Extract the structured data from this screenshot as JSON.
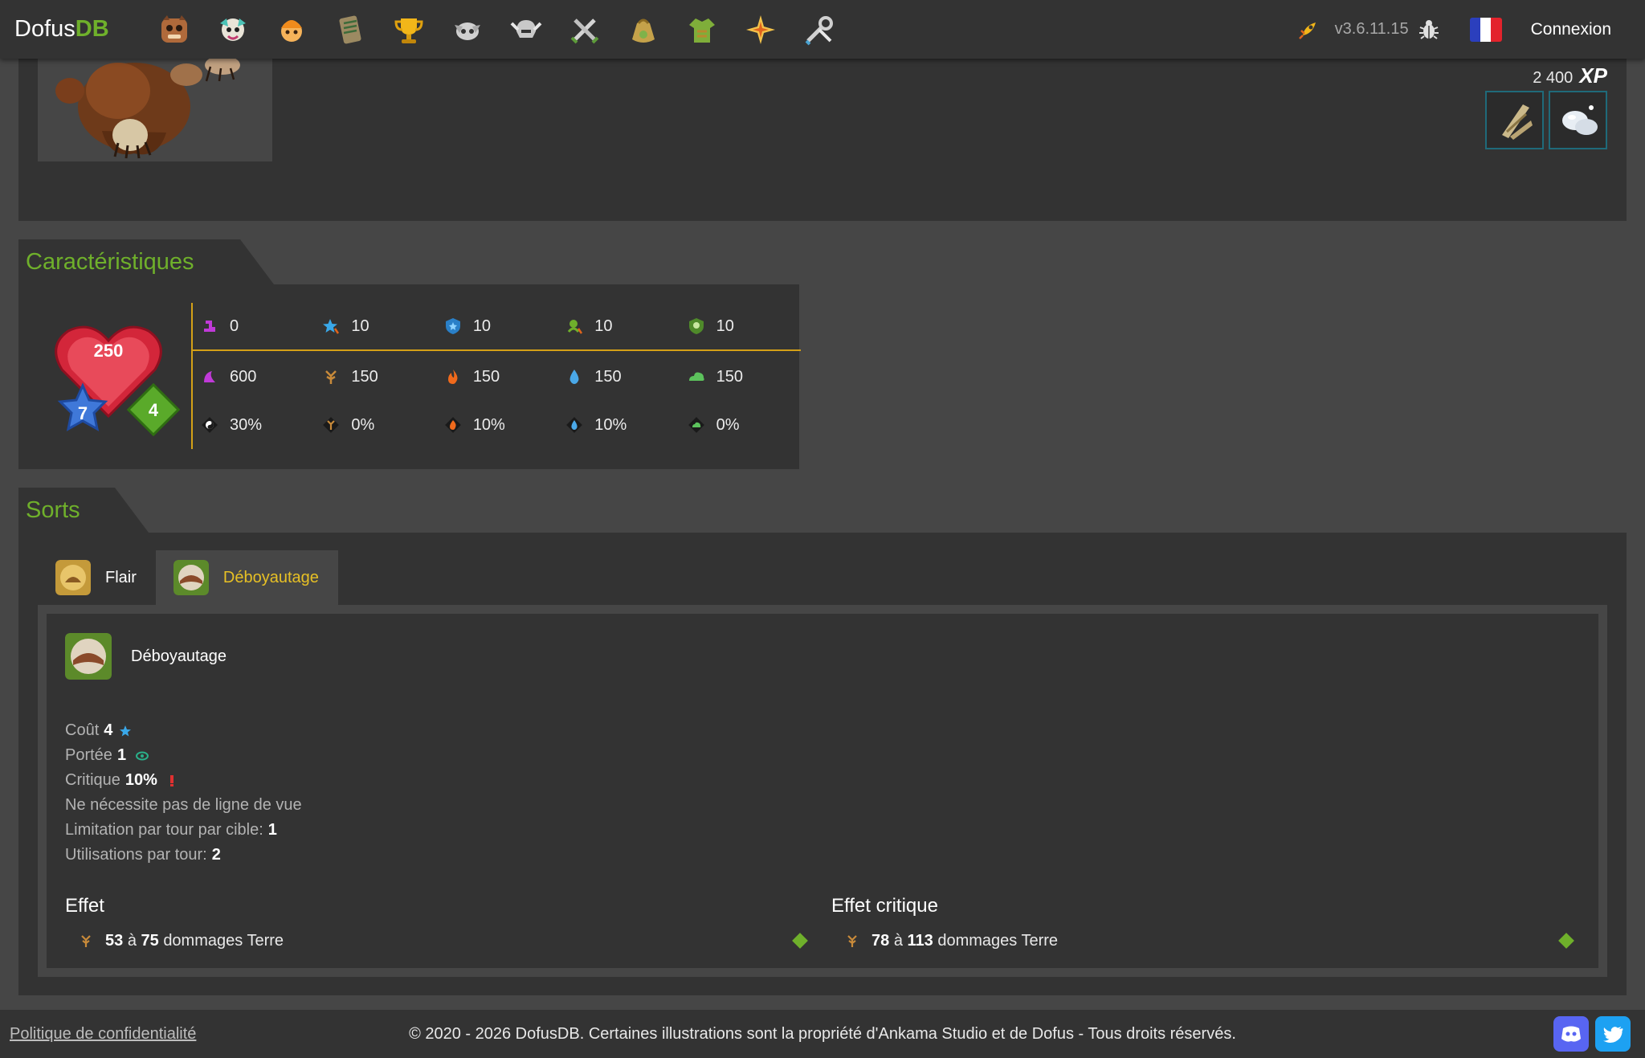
{
  "navbar": {
    "brand_prefix": "Dofus",
    "brand_suffix": "DB",
    "icons": [
      "monster-icon",
      "character-icon",
      "npc-icon",
      "scroll-icon",
      "trophy-icon",
      "dungeon-icon",
      "helmet-icon",
      "weapons-icon",
      "bag-icon",
      "equipment-icon",
      "spell-icon",
      "tools-icon"
    ],
    "version": "v3.6.11.15",
    "login_label": "Connexion",
    "language_flag": "fr-flag-icon"
  },
  "monster": {
    "xp_value": "2 400",
    "xp_label": "XP",
    "drops": [
      "wood-drop-icon",
      "pearl-drop-icon"
    ]
  },
  "caracteristiques": {
    "title": "Caractéristiques",
    "level": "250",
    "pa": "7",
    "pm": "4",
    "row1": [
      "0",
      "10",
      "10",
      "10",
      "10"
    ],
    "row2": [
      "600",
      "150",
      "150",
      "150",
      "150"
    ],
    "row3": [
      "30%",
      "0%",
      "10%",
      "10%",
      "0%"
    ]
  },
  "sorts": {
    "title": "Sorts",
    "tabs": [
      {
        "label": "Flair",
        "active": false
      },
      {
        "label": "Déboyautage",
        "active": true
      }
    ],
    "spell": {
      "name": "Déboyautage",
      "cost_label": "Coût",
      "cost_value": "4",
      "range_label": "Portée",
      "range_value": "1",
      "crit_label": "Critique",
      "crit_value": "10%",
      "los_text": "Ne nécessite pas de ligne de vue",
      "limit_label": "Limitation par tour par cible:",
      "limit_value": "1",
      "uses_label": "Utilisations par tour:",
      "uses_value": "2",
      "effect_title": "Effet",
      "effect_min": "53",
      "effect_sep": "à",
      "effect_max": "75",
      "effect_text": "dommages Terre",
      "crit_effect_title": "Effet critique",
      "crit_effect_min": "78",
      "crit_effect_sep": "à",
      "crit_effect_max": "113",
      "crit_effect_text": "dommages Terre"
    }
  },
  "footer": {
    "privacy": "Politique de confidentialité",
    "copyright": "© 2020 - 2026 DofusDB. Certaines illustrations sont la propriété d'Ankama Studio et de Dofus - Tous droits réservés."
  },
  "colors": {
    "accent_green": "#6fb02b",
    "gold": "#d4a017",
    "active_tab_text": "#e7c025"
  }
}
